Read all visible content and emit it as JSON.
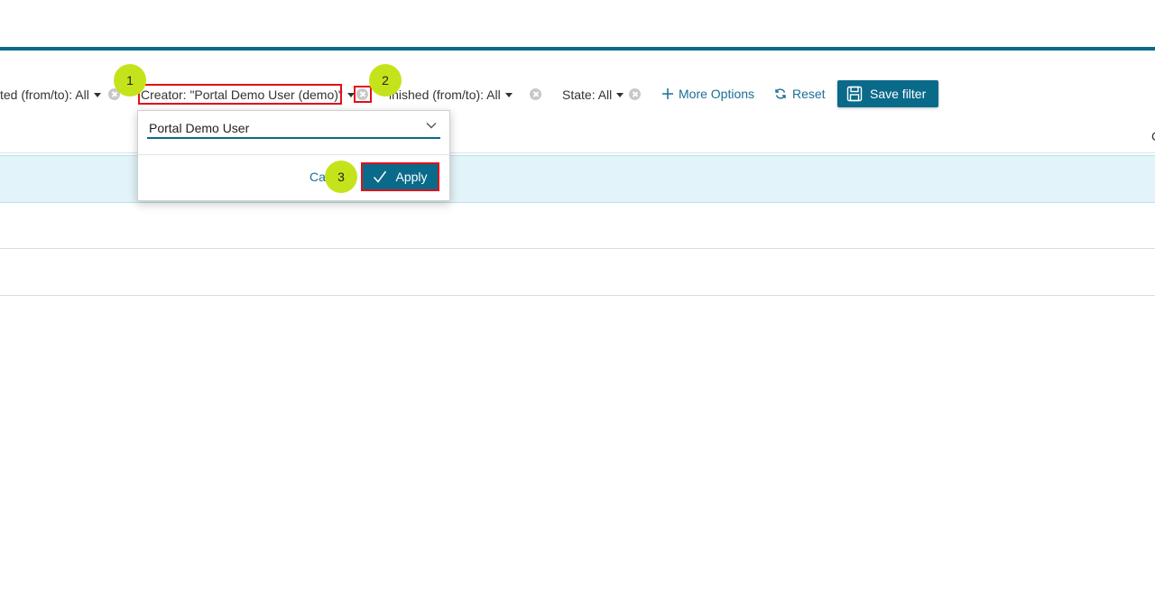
{
  "filters": {
    "created_label": "ted (from/to): All",
    "creator_label": "Creator: \"Portal Demo User (demo)\"",
    "finished_label": "inished (from/to): All",
    "state_label": "State: All",
    "more_options_label": "More Options",
    "reset_label": "Reset",
    "save_filter_label": "Save filter"
  },
  "table": {
    "partial_header_char": "C"
  },
  "popover": {
    "selected_value": "Portal Demo User",
    "cancel_label": "Ca",
    "apply_label": "Apply"
  },
  "markers": [
    "1",
    "2",
    "3"
  ],
  "colors": {
    "accent": "#0a6a8a",
    "link": "#1a6f95",
    "highlight": "#e0101a",
    "marker": "#c5e31a",
    "selected_row": "#e2f4f9"
  },
  "icons": {
    "clear": "clear-circle-icon",
    "caret": "caret-down-icon",
    "plus": "plus-icon",
    "reset": "refresh-icon",
    "save": "floppy-disk-icon",
    "chevron": "chevron-down-icon",
    "check": "check-icon"
  }
}
